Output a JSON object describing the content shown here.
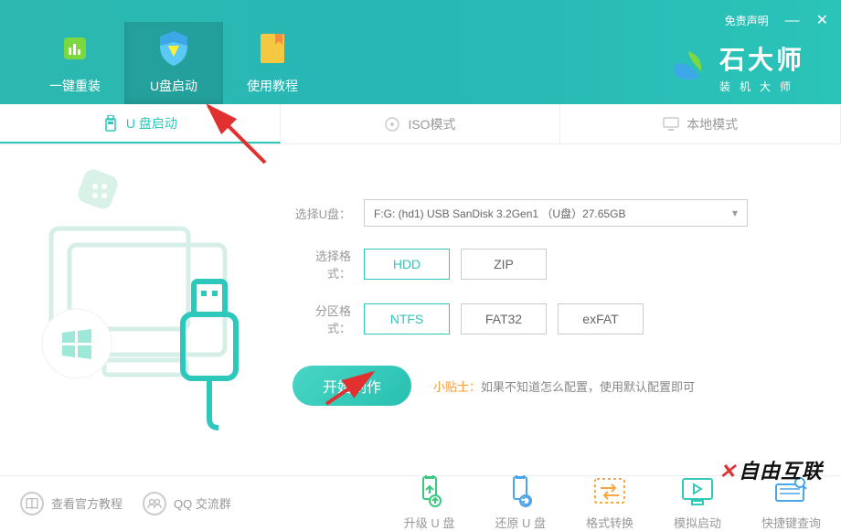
{
  "titlebar": {
    "disclaimer": "免责声明"
  },
  "brand": {
    "title": "石大师",
    "sub": "装机大师"
  },
  "header_tabs": [
    {
      "label": "一键重装"
    },
    {
      "label": "U盘启动"
    },
    {
      "label": "使用教程"
    }
  ],
  "subnav": [
    {
      "label": "U 盘启动"
    },
    {
      "label": "ISO模式"
    },
    {
      "label": "本地模式"
    }
  ],
  "form": {
    "usb_label": "选择U盘：",
    "usb_value": "F:G: (hd1)  USB SanDisk 3.2Gen1 （U盘）27.65GB",
    "format_label": "选择格式：",
    "format_options": [
      "HDD",
      "ZIP"
    ],
    "partition_label": "分区格式：",
    "partition_options": [
      "NTFS",
      "FAT32",
      "exFAT"
    ]
  },
  "action": {
    "button": "开始制作",
    "tip_label": "小贴士：",
    "tip_text": "如果不知道怎么配置，使用默认配置即可"
  },
  "bottom_links": [
    {
      "label": "查看官方教程"
    },
    {
      "label": "QQ 交流群"
    }
  ],
  "bottom_tools": [
    {
      "label": "升级 U 盘",
      "color": "#3cc97f"
    },
    {
      "label": "还原 U 盘",
      "color": "#4aa6e8"
    },
    {
      "label": "格式转换",
      "color": "#f5a742"
    },
    {
      "label": "模拟启动",
      "color": "#33c9b9"
    },
    {
      "label": "快捷键查询",
      "color": "#4aa6e8"
    }
  ],
  "watermark": "自由互联"
}
